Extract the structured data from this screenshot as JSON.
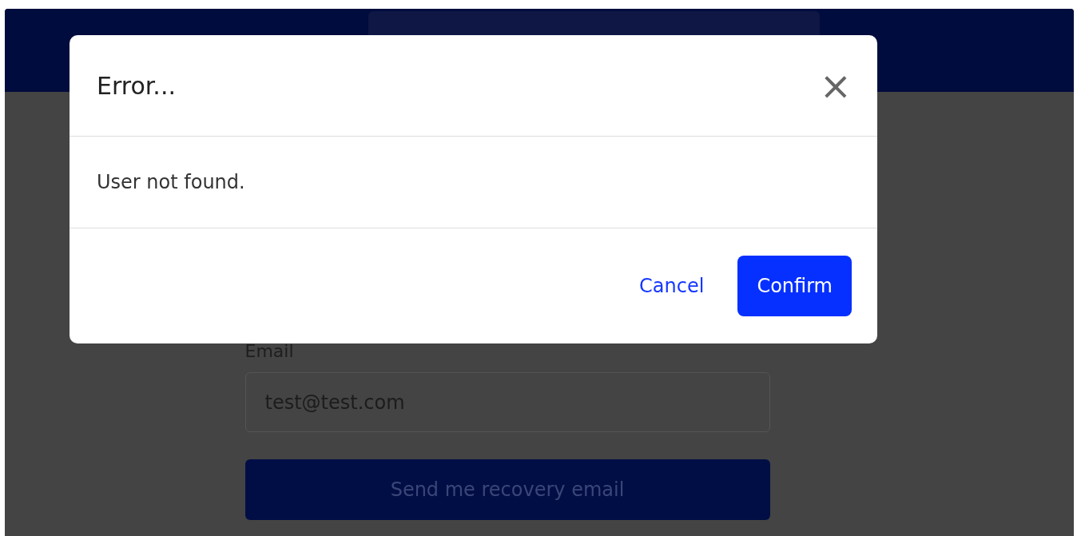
{
  "form": {
    "email_label": "Email",
    "email_value": "test@test.com",
    "submit_button": "Send me recovery email"
  },
  "dialog": {
    "title": "Error...",
    "close": "×",
    "message": "User not found.",
    "buttons": [
      {
        "label": "Cancel",
        "kind": "link"
      },
      {
        "label": "Confirm",
        "kind": "primary"
      }
    ]
  }
}
